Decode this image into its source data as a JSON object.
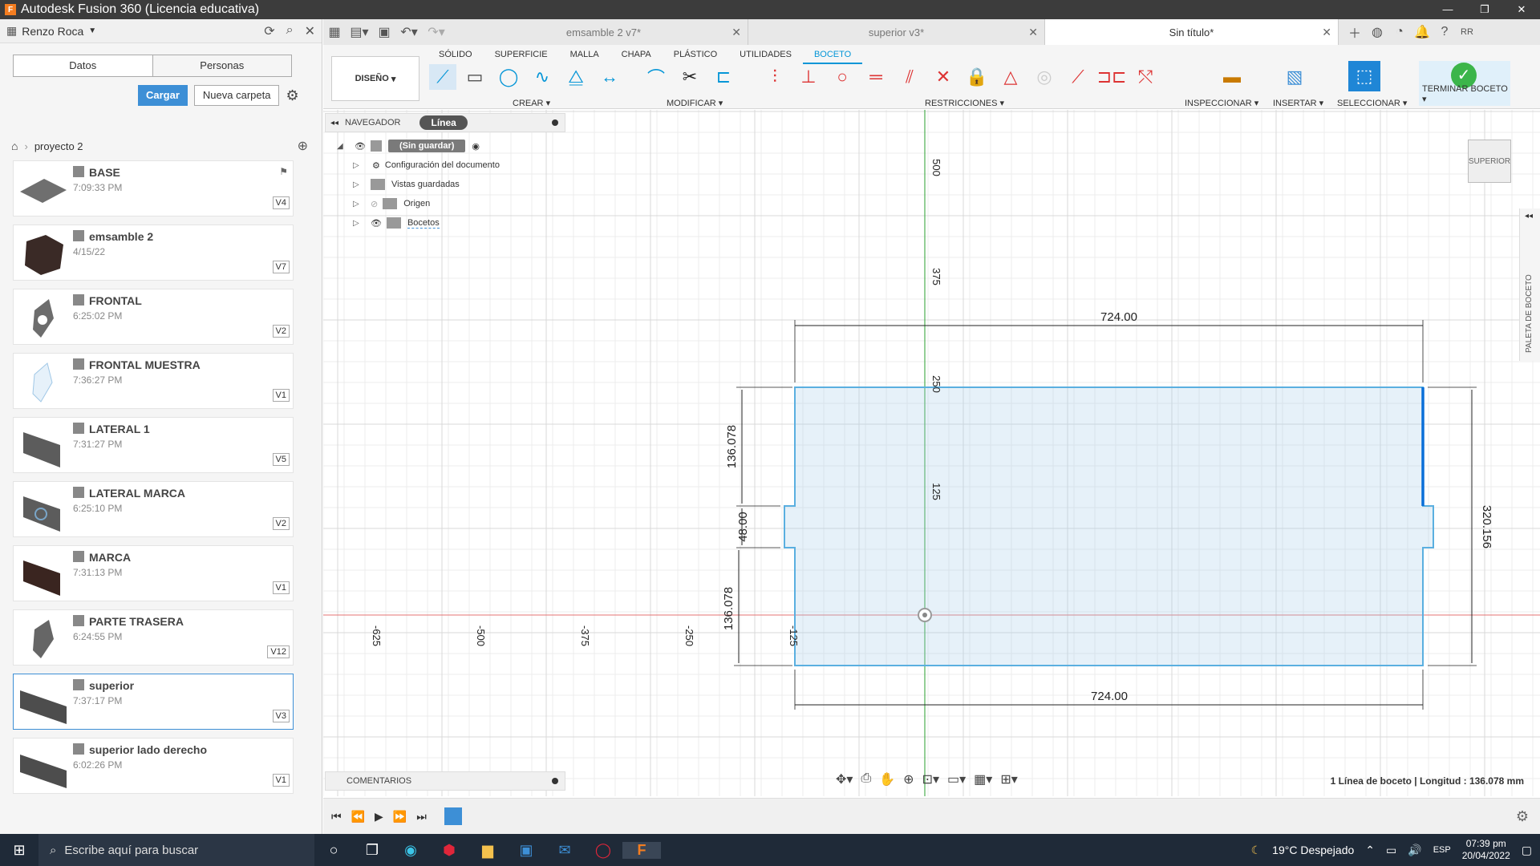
{
  "window": {
    "title": "Autodesk Fusion 360 (Licencia educativa)",
    "app_icon": "F"
  },
  "datapanel": {
    "user": "Renzo Roca",
    "tabs": [
      "Datos",
      "Personas"
    ],
    "upload_label": "Cargar",
    "new_folder_label": "Nueva carpeta",
    "breadcrumb": "proyecto 2",
    "files": [
      {
        "name": "BASE",
        "time": "7:09:33 PM",
        "version": "V4"
      },
      {
        "name": "emsamble 2",
        "time": "4/15/22",
        "version": "V7"
      },
      {
        "name": "FRONTAL",
        "time": "6:25:02 PM",
        "version": "V2"
      },
      {
        "name": "FRONTAL MUESTRA",
        "time": "7:36:27 PM",
        "version": "V1"
      },
      {
        "name": "LATERAL 1",
        "time": "7:31:27 PM",
        "version": "V5"
      },
      {
        "name": "LATERAL MARCA",
        "time": "6:25:10 PM",
        "version": "V2"
      },
      {
        "name": "MARCA",
        "time": "7:31:13 PM",
        "version": "V1"
      },
      {
        "name": "PARTE TRASERA",
        "time": "6:24:55 PM",
        "version": "V12"
      },
      {
        "name": "superior",
        "time": "7:37:17 PM",
        "version": "V3"
      },
      {
        "name": "superior lado derecho",
        "time": "6:02:26 PM",
        "version": "V1"
      }
    ]
  },
  "doctabs": [
    {
      "label": "emsamble 2 v7*"
    },
    {
      "label": "superior v3*"
    },
    {
      "label": "Sin título*"
    }
  ],
  "ribbon": {
    "workspace": "DISEÑO",
    "tabs": [
      "SÓLIDO",
      "SUPERFICIE",
      "MALLA",
      "CHAPA",
      "PLÁSTICO",
      "UTILIDADES",
      "BOCETO"
    ],
    "groups": {
      "crear": "CREAR",
      "modificar": "MODIFICAR",
      "restricciones": "RESTRICCIONES",
      "inspeccionar": "INSPECCIONAR",
      "insertar": "INSERTAR",
      "seleccionar": "SELECCIONAR",
      "terminar": "TERMINAR BOCETO"
    }
  },
  "navigator": {
    "title": "NAVEGADOR",
    "mode": "Línea",
    "root": "(Sin guardar)",
    "items": [
      "Configuración del documento",
      "Vistas guardadas",
      "Origen",
      "Bocetos"
    ]
  },
  "comments_label": "COMENTARIOS",
  "viewcube_label": "SUPERIOR",
  "palette_label": "PALETA DE BOCETO",
  "status": "1 Línea de boceto | Longitud : 136.078 mm",
  "sketch": {
    "dim_top": "724.00",
    "dim_bottom": "724.00",
    "dim_left_top": "136.078",
    "dim_left_mid": "48.00",
    "dim_left_bottom": "136.078",
    "dim_right": "320.156",
    "axis_labels_x": [
      "-625",
      "-500",
      "-375",
      "-250",
      "-125"
    ],
    "axis_labels_y": [
      "500",
      "375",
      "250",
      "125"
    ]
  },
  "taskbar": {
    "search_placeholder": "Escribe aquí para buscar",
    "weather": "19°C  Despejado",
    "lang": "ESP",
    "time": "07:39 pm",
    "date": "20/04/2022"
  }
}
